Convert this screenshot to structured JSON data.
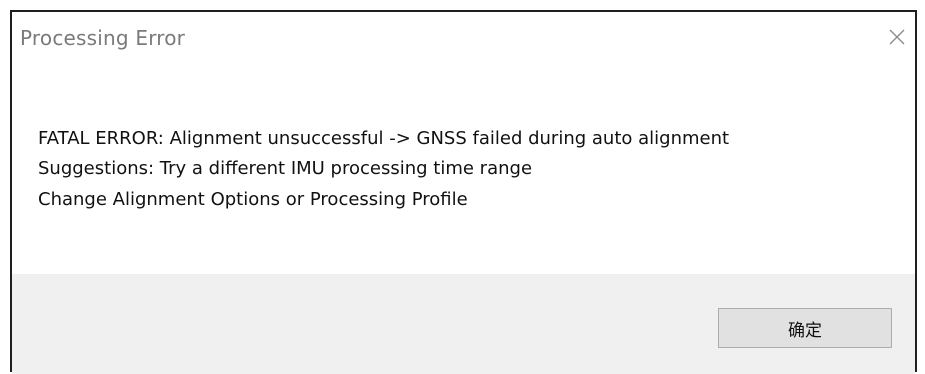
{
  "dialog": {
    "title": "Processing Error",
    "close_icon": "close-icon",
    "message_lines": [
      "FATAL ERROR: Alignment unsuccessful -> GNSS failed during auto alignment",
      "Suggestions: Try a different IMU processing time range",
      "Change Alignment Options or Processing Profile"
    ],
    "ok_label": "确定"
  },
  "colors": {
    "title_text": "#7a7a7a",
    "footer_bg": "#f0f0f0",
    "button_bg": "#e1e1e1",
    "button_border": "#adadad",
    "frame": "#1f1f1f"
  }
}
